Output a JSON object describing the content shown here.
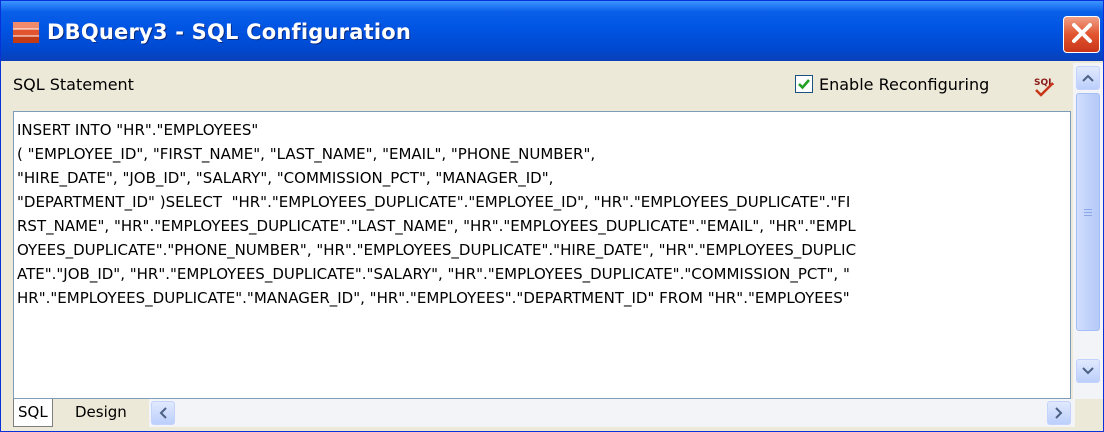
{
  "window": {
    "title": "DBQuery3 - SQL Configuration",
    "icon": "database-icon",
    "close_icon": "close-icon"
  },
  "toolbar": {
    "statement_label": "SQL Statement",
    "enable_reconfiguring_label": "Enable Reconfiguring",
    "enable_reconfiguring_checked": true,
    "sql_tool_icon": "sql-edit-icon"
  },
  "editor": {
    "sql_text": "INSERT INTO \"HR\".\"EMPLOYEES\"\n( \"EMPLOYEE_ID\", \"FIRST_NAME\", \"LAST_NAME\", \"EMAIL\", \"PHONE_NUMBER\",\n\"HIRE_DATE\", \"JOB_ID\", \"SALARY\", \"COMMISSION_PCT\", \"MANAGER_ID\",\n\"DEPARTMENT_ID\" )SELECT  \"HR\".\"EMPLOYEES_DUPLICATE\".\"EMPLOYEE_ID\", \"HR\".\"EMPLOYEES_DUPLICATE\".\"FI\nRST_NAME\", \"HR\".\"EMPLOYEES_DUPLICATE\".\"LAST_NAME\", \"HR\".\"EMPLOYEES_DUPLICATE\".\"EMAIL\", \"HR\".\"EMPL\nOYEES_DUPLICATE\".\"PHONE_NUMBER\", \"HR\".\"EMPLOYEES_DUPLICATE\".\"HIRE_DATE\", \"HR\".\"EMPLOYEES_DUPLIC\nATE\".\"JOB_ID\", \"HR\".\"EMPLOYEES_DUPLICATE\".\"SALARY\", \"HR\".\"EMPLOYEES_DUPLICATE\".\"COMMISSION_PCT\", \"\nHR\".\"EMPLOYEES_DUPLICATE\".\"MANAGER_ID\", \"HR\".\"EMPLOYEES\".\"DEPARTMENT_ID\" FROM \"HR\".\"EMPLOYEES\""
  },
  "tabs": [
    {
      "label": "SQL",
      "active": true
    },
    {
      "label": "Design",
      "active": false
    }
  ],
  "colors": {
    "titlebar_blue": "#0054e3",
    "close_red": "#e2542f",
    "window_bg": "#ece9d8",
    "checkmark_green": "#21a121"
  }
}
